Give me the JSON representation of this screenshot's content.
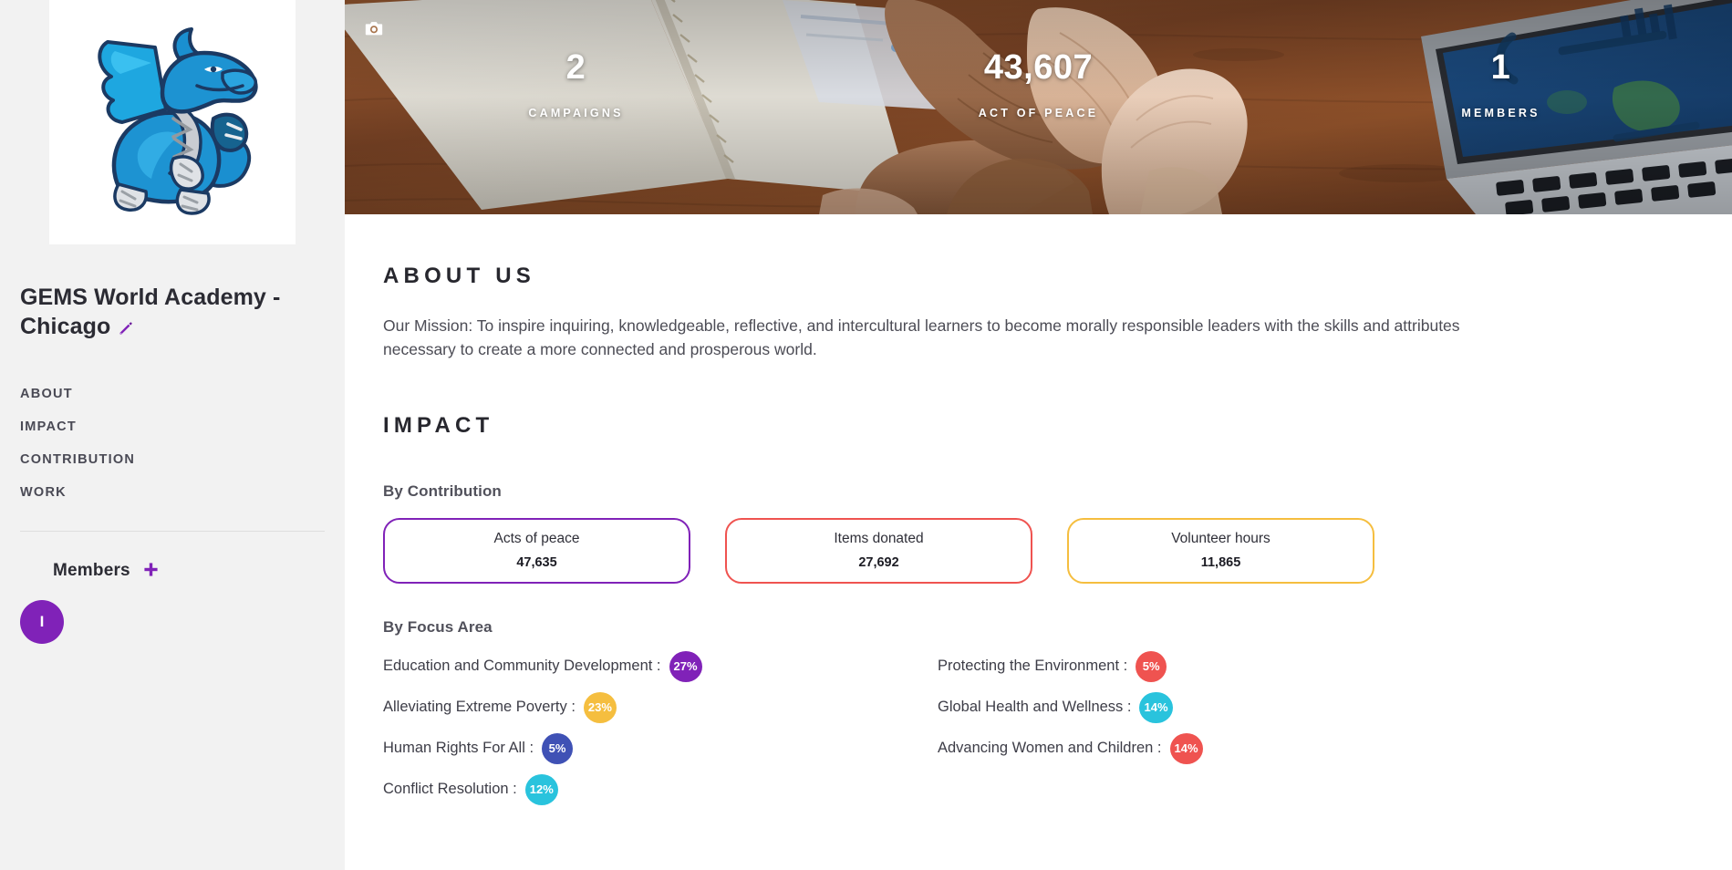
{
  "sidebar": {
    "logo_alt": "blue-dragon-mascot",
    "org_name": "GEMS World Academy - Chicago",
    "edit_icon": "pencil-icon",
    "nav": [
      {
        "label": "ABOUT"
      },
      {
        "label": "IMPACT"
      },
      {
        "label": "CONTRIBUTION"
      },
      {
        "label": "WORK"
      }
    ],
    "members": {
      "title": "Members",
      "add_icon": "plus-icon",
      "avatars": [
        {
          "initial": "I",
          "color": "#8022b8"
        }
      ]
    }
  },
  "hero": {
    "camera_icon": "camera-icon",
    "stats": [
      {
        "value": "2",
        "label": "CAMPAIGNS"
      },
      {
        "value": "43,607",
        "label": "ACT OF PEACE"
      },
      {
        "value": "1",
        "label": "MEMBERS"
      }
    ]
  },
  "about": {
    "title": "ABOUT US",
    "body": "Our Mission: To inspire inquiring, knowledgeable, reflective, and intercultural learners to become morally responsible leaders with the skills and attributes necessary to create a more connected and prosperous world."
  },
  "impact": {
    "title": "IMPACT",
    "by_contribution_label": "By Contribution",
    "contributions": [
      {
        "label": "Acts of peace",
        "value": "47,635",
        "color": "#8022b8"
      },
      {
        "label": "Items donated",
        "value": "27,692",
        "color": "#ef5350"
      },
      {
        "label": "Volunteer hours",
        "value": "11,865",
        "color": "#f5be3f"
      }
    ],
    "by_focus_area_label": "By Focus Area",
    "focus_left": [
      {
        "label": "Education and Community Development :",
        "percent": "27%",
        "color": "#8022b8"
      },
      {
        "label": "Alleviating Extreme Poverty :",
        "percent": "23%",
        "color": "#f5be3f"
      },
      {
        "label": "Human Rights For All :",
        "percent": "5%",
        "color": "#3f51b5"
      },
      {
        "label": "Conflict Resolution :",
        "percent": "12%",
        "color": "#29c3dd"
      }
    ],
    "focus_right": [
      {
        "label": "Protecting the Environment :",
        "percent": "5%",
        "color": "#ef5350"
      },
      {
        "label": "Global Health and Wellness :",
        "percent": "14%",
        "color": "#29c3dd"
      },
      {
        "label": "Advancing Women and Children :",
        "percent": "14%",
        "color": "#ef5350"
      }
    ]
  },
  "theme": {
    "accent_purple": "#8022b8",
    "accent_red": "#ef5350",
    "accent_yellow": "#f5be3f",
    "accent_cyan": "#29c3dd",
    "accent_blue": "#3f51b5",
    "sidebar_bg": "#f2f2f2"
  }
}
